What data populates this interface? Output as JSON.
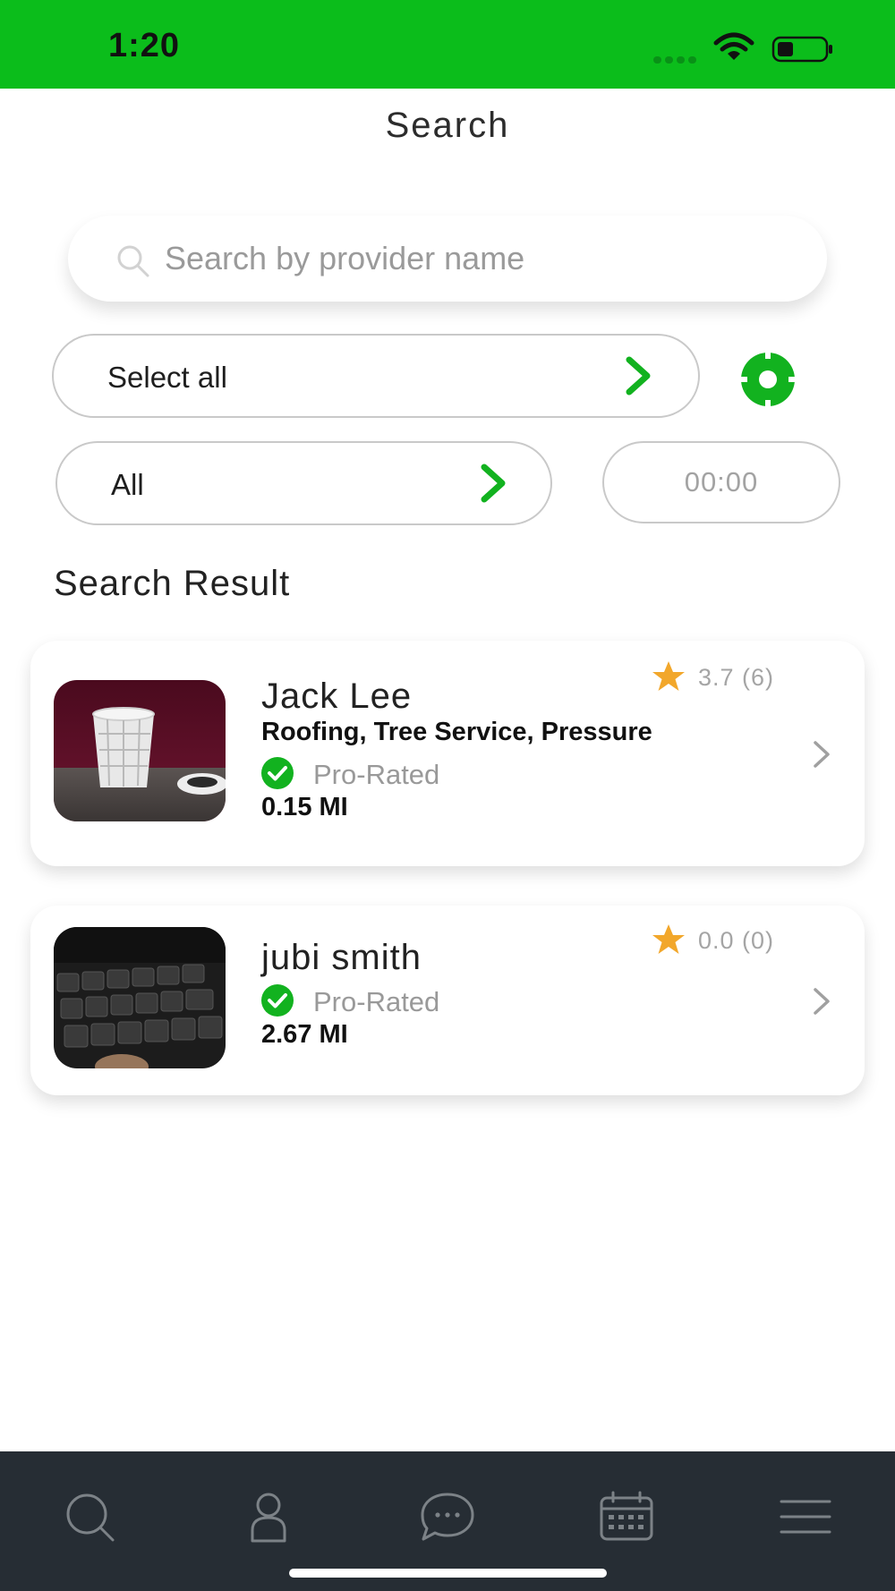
{
  "status_bar": {
    "time": "1:20",
    "color": "#0bbd1b"
  },
  "header": {
    "title": "Search"
  },
  "search": {
    "placeholder": "Search by provider name",
    "value": ""
  },
  "filters": {
    "primary_label": "Select all",
    "category_label": "All",
    "time_value": "00:00",
    "accent_color": "#12b21f"
  },
  "results": {
    "heading": "Search Result",
    "items": [
      {
        "name": "Jack Lee",
        "services": "Roofing, Tree Service, Pressure",
        "badge": "Pro-Rated",
        "distance": "0.15 MI",
        "rating": "3.7 (6)"
      },
      {
        "name": "jubi smith",
        "badge": "Pro-Rated",
        "distance": "2.67 MI",
        "rating": "0.0 (0)"
      }
    ]
  },
  "tab_bar": {
    "tabs": [
      {
        "icon": "search-icon"
      },
      {
        "icon": "profile-icon"
      },
      {
        "icon": "chat-icon"
      },
      {
        "icon": "calendar-icon"
      },
      {
        "icon": "menu-icon"
      }
    ]
  },
  "colors": {
    "star": "#f2a72b",
    "tab_bar": "#262d34",
    "check": "#12b21f"
  }
}
